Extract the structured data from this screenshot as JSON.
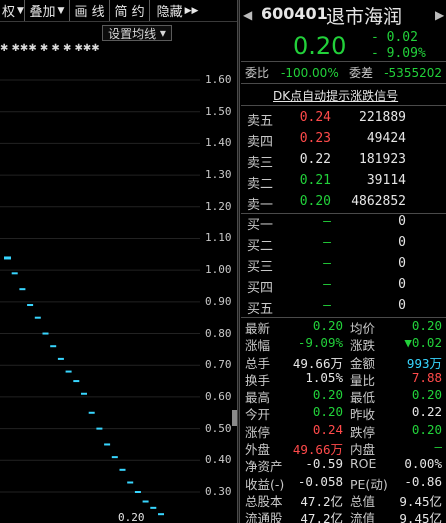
{
  "toolbar": {
    "buttons": [
      {
        "label": "权",
        "arrow": "▼"
      },
      {
        "label": "叠加",
        "arrow": "▼"
      },
      {
        "label": "画 线",
        "arrow": ""
      },
      {
        "label": "简 约",
        "arrow": ""
      },
      {
        "label": "隐藏",
        "arrow": "▶▶"
      }
    ]
  },
  "chart": {
    "ma_button": "设置均线",
    "ma_arrow": "▾",
    "stars": "✱    ✱✱✱   ✱   ✱   ✱       ✱✱✱",
    "y_labels": [
      "1.60",
      "1.50",
      "1.40",
      "1.30",
      "1.20",
      "1.10",
      "1.00",
      "0.90",
      "0.80",
      "0.70",
      "0.60",
      "0.50",
      "0.40",
      "0.30"
    ],
    "last_price": "0.20",
    "colors": {
      "candle": "#38d6ff",
      "grid": "#222222"
    }
  },
  "chart_data": {
    "type": "candlestick",
    "y_ticks": [
      1.6,
      1.5,
      1.4,
      1.3,
      1.2,
      1.1,
      1.0,
      0.9,
      0.8,
      0.7,
      0.6,
      0.5,
      0.4,
      0.3
    ],
    "ylim": [
      0.22,
      1.68
    ],
    "points": [
      {
        "x": 1,
        "y": 1.04
      },
      {
        "x": 2,
        "y": 0.99
      },
      {
        "x": 3,
        "y": 0.94
      },
      {
        "x": 4,
        "y": 0.89
      },
      {
        "x": 5,
        "y": 0.85
      },
      {
        "x": 6,
        "y": 0.8
      },
      {
        "x": 7,
        "y": 0.76
      },
      {
        "x": 8,
        "y": 0.72
      },
      {
        "x": 9,
        "y": 0.68
      },
      {
        "x": 10,
        "y": 0.65
      },
      {
        "x": 11,
        "y": 0.61
      },
      {
        "x": 12,
        "y": 0.55
      },
      {
        "x": 13,
        "y": 0.5
      },
      {
        "x": 14,
        "y": 0.45
      },
      {
        "x": 15,
        "y": 0.41
      },
      {
        "x": 16,
        "y": 0.37
      },
      {
        "x": 17,
        "y": 0.33
      },
      {
        "x": 18,
        "y": 0.3
      },
      {
        "x": 19,
        "y": 0.27
      },
      {
        "x": 20,
        "y": 0.25
      },
      {
        "x": 21,
        "y": 0.23
      }
    ]
  },
  "quote": {
    "code": "600401",
    "name": "退市海润",
    "price": "0.20",
    "change": "- 0.02",
    "change_pct": "- 9.09%",
    "nav_left": "◀",
    "nav_right": "▶"
  },
  "weibi": {
    "label1": "委比",
    "value1": "-100.00%",
    "label2": "委差",
    "value2": "-5355202"
  },
  "banner": "DK点自动提示涨跌信号",
  "orderbook": {
    "sells": [
      {
        "label": "卖五",
        "price": "0.24",
        "vol": "221889",
        "color": "red"
      },
      {
        "label": "卖四",
        "price": "0.23",
        "vol": "49424",
        "color": "red"
      },
      {
        "label": "卖三",
        "price": "0.22",
        "vol": "181923",
        "color": "white"
      },
      {
        "label": "卖二",
        "price": "0.21",
        "vol": "39114",
        "color": "green"
      },
      {
        "label": "卖一",
        "price": "0.20",
        "vol": "4862852",
        "color": "green"
      }
    ],
    "buys": [
      {
        "label": "买一",
        "price": "—",
        "vol": "0",
        "color": "green"
      },
      {
        "label": "买二",
        "price": "—",
        "vol": "0",
        "color": "green"
      },
      {
        "label": "买三",
        "price": "—",
        "vol": "0",
        "color": "green"
      },
      {
        "label": "买四",
        "price": "—",
        "vol": "0",
        "color": "green"
      },
      {
        "label": "买五",
        "price": "—",
        "vol": "0",
        "color": "green"
      }
    ]
  },
  "stats": [
    {
      "k1": "最新",
      "v1": "0.20",
      "c1": "green",
      "k2": "均价",
      "v2": "0.20",
      "c2": "green"
    },
    {
      "k1": "涨幅",
      "v1": "-9.09%",
      "c1": "green",
      "k2": "涨跌",
      "v2": "▼0.02",
      "c2": "green"
    },
    {
      "k1": "总手",
      "v1": "49.66万",
      "c1": "white",
      "k2": "金额",
      "v2": "993万",
      "c2": "cyan"
    },
    {
      "k1": "换手",
      "v1": "1.05%",
      "c1": "white",
      "k2": "量比",
      "v2": "7.88",
      "c2": "red"
    },
    {
      "k1": "最高",
      "v1": "0.20",
      "c1": "green",
      "k2": "最低",
      "v2": "0.20",
      "c2": "green"
    },
    {
      "k1": "今开",
      "v1": "0.20",
      "c1": "green",
      "k2": "昨收",
      "v2": "0.22",
      "c2": "white"
    },
    {
      "k1": "涨停",
      "v1": "0.24",
      "c1": "red",
      "k2": "跌停",
      "v2": "0.20",
      "c2": "green"
    },
    {
      "k1": "外盘",
      "v1": "49.66万",
      "c1": "red",
      "k2": "内盘",
      "v2": "—",
      "c2": "green"
    },
    {
      "k1": "净资产",
      "v1": "-0.59",
      "c1": "white",
      "k2": "ROE",
      "v2": "0.00%",
      "c2": "white"
    },
    {
      "k1": "收益(-)",
      "v1": "-0.058",
      "c1": "white",
      "k2": "PE(动)",
      "v2": "-0.86",
      "c2": "white"
    },
    {
      "k1": "总股本",
      "v1": "47.2亿",
      "c1": "white",
      "k2": "总值",
      "v2": "9.45亿",
      "c2": "white"
    },
    {
      "k1": "流通股",
      "v1": "47.2亿",
      "c1": "white",
      "k2": "流值",
      "v2": "9.45亿",
      "c2": "white"
    }
  ]
}
